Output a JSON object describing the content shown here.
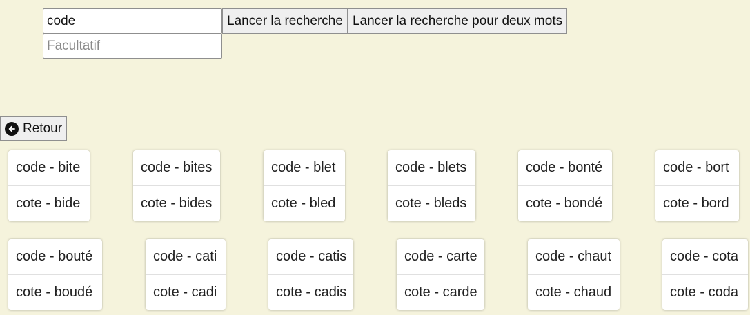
{
  "search": {
    "query_value": "code",
    "search_label": "Lancer la recherche",
    "two_words_label": "Lancer la recherche pour deux mots",
    "optional_placeholder": "Facultatif",
    "optional_value": ""
  },
  "back": {
    "label": "Retour",
    "icon": "arrow-left-circle-icon"
  },
  "pairs": [
    {
      "line1": "code - bite",
      "line2": "cote - bide"
    },
    {
      "line1": "code - bites",
      "line2": "cote - bides"
    },
    {
      "line1": "code - blet",
      "line2": "cote - bled"
    },
    {
      "line1": "code - blets",
      "line2": "cote - bleds"
    },
    {
      "line1": "code - bonté",
      "line2": "cote - bondé"
    },
    {
      "line1": "code - bort",
      "line2": "cote - bord"
    },
    {
      "line1": "code - bouté",
      "line2": "cote - boudé"
    },
    {
      "line1": "code - cati",
      "line2": "cote - cadi"
    },
    {
      "line1": "code - catis",
      "line2": "cote - cadis"
    },
    {
      "line1": "code - carte",
      "line2": "cote - carde"
    },
    {
      "line1": "code - chaut",
      "line2": "cote - chaud"
    },
    {
      "line1": "code - cota",
      "line2": "cote - coda"
    }
  ]
}
